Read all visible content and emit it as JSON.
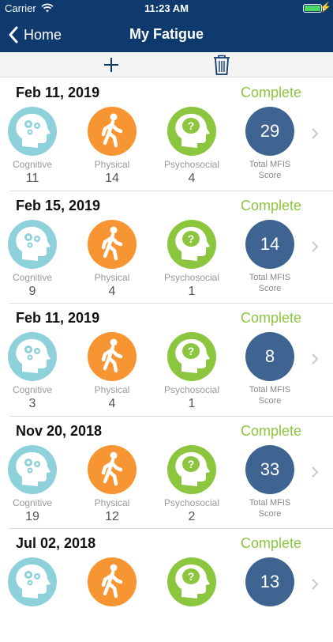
{
  "status_bar": {
    "carrier": "Carrier",
    "time": "11:23 AM"
  },
  "nav": {
    "back_label": "Home",
    "title": "My Fatigue"
  },
  "labels": {
    "cognitive": "Cognitive",
    "physical": "Physical",
    "psychosocial": "Psychosocial",
    "total_line1": "Total MFIS",
    "total_line2": "Score"
  },
  "entries": [
    {
      "date": "Feb 11, 2019",
      "status": "Complete",
      "cognitive": "11",
      "physical": "14",
      "psychosocial": "4",
      "total": "29"
    },
    {
      "date": "Feb 15, 2019",
      "status": "Complete",
      "cognitive": "9",
      "physical": "4",
      "psychosocial": "1",
      "total": "14"
    },
    {
      "date": "Feb 11, 2019",
      "status": "Complete",
      "cognitive": "3",
      "physical": "4",
      "psychosocial": "1",
      "total": "8"
    },
    {
      "date": "Nov 20, 2018",
      "status": "Complete",
      "cognitive": "19",
      "physical": "12",
      "psychosocial": "2",
      "total": "33"
    },
    {
      "date": "Jul 02, 2018",
      "status": "Complete",
      "cognitive": "",
      "physical": "",
      "psychosocial": "",
      "total": "13"
    }
  ],
  "colors": {
    "nav_bg": "#0f3a6e",
    "complete": "#8cc63f",
    "cognitive": "#8fd1db",
    "physical": "#f79533",
    "psychosocial": "#8cc63f",
    "total": "#3f6491"
  },
  "icons": {
    "back": "chevron-left-icon",
    "add": "plus-icon",
    "delete": "trash-icon",
    "cognitive": "head-gears-icon",
    "physical": "walking-person-icon",
    "psychosocial": "head-question-icon",
    "row_detail": "chevron-right-icon"
  }
}
